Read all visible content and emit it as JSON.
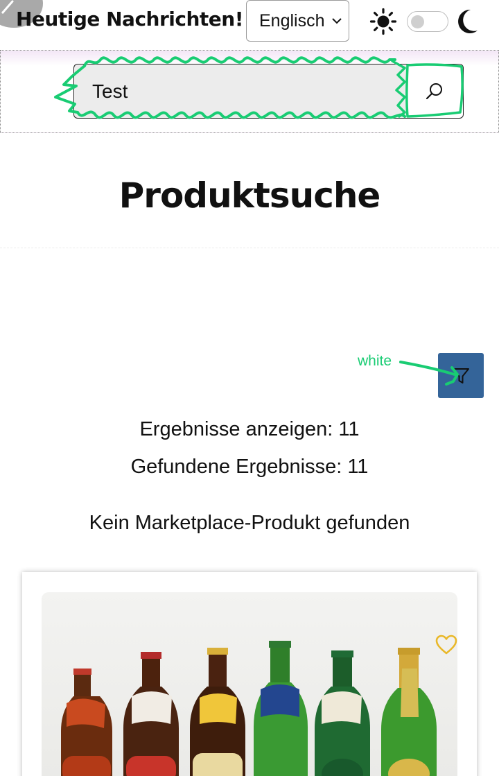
{
  "header": {
    "site_title": "Heutige Nachrichten!",
    "language_select": {
      "selected": "Englisch"
    },
    "theme_toggle": {
      "state": "light"
    },
    "icons": {
      "corner": "pencil-icon",
      "sun": "sun-icon",
      "moon": "moon-icon",
      "chevron": "chevron-down-icon"
    }
  },
  "search": {
    "value": "Test",
    "button_icon": "search-icon"
  },
  "page": {
    "title": "Produktsuche"
  },
  "filter": {
    "icon": "filter-icon",
    "color": "#346499",
    "annotation": "white",
    "annotation_color": "#19cc73"
  },
  "results": {
    "shown": "Ergebnisse anzeigen: 11",
    "found": "Gefundene Ergebnisse: 11",
    "marketplace_message": "Kein Marketplace-Produkt gefunden"
  },
  "product_card": {
    "image_subject": "beer-bottles-photo",
    "favorite_icon": "heart-icon",
    "favorite_color": "#e9b829"
  }
}
